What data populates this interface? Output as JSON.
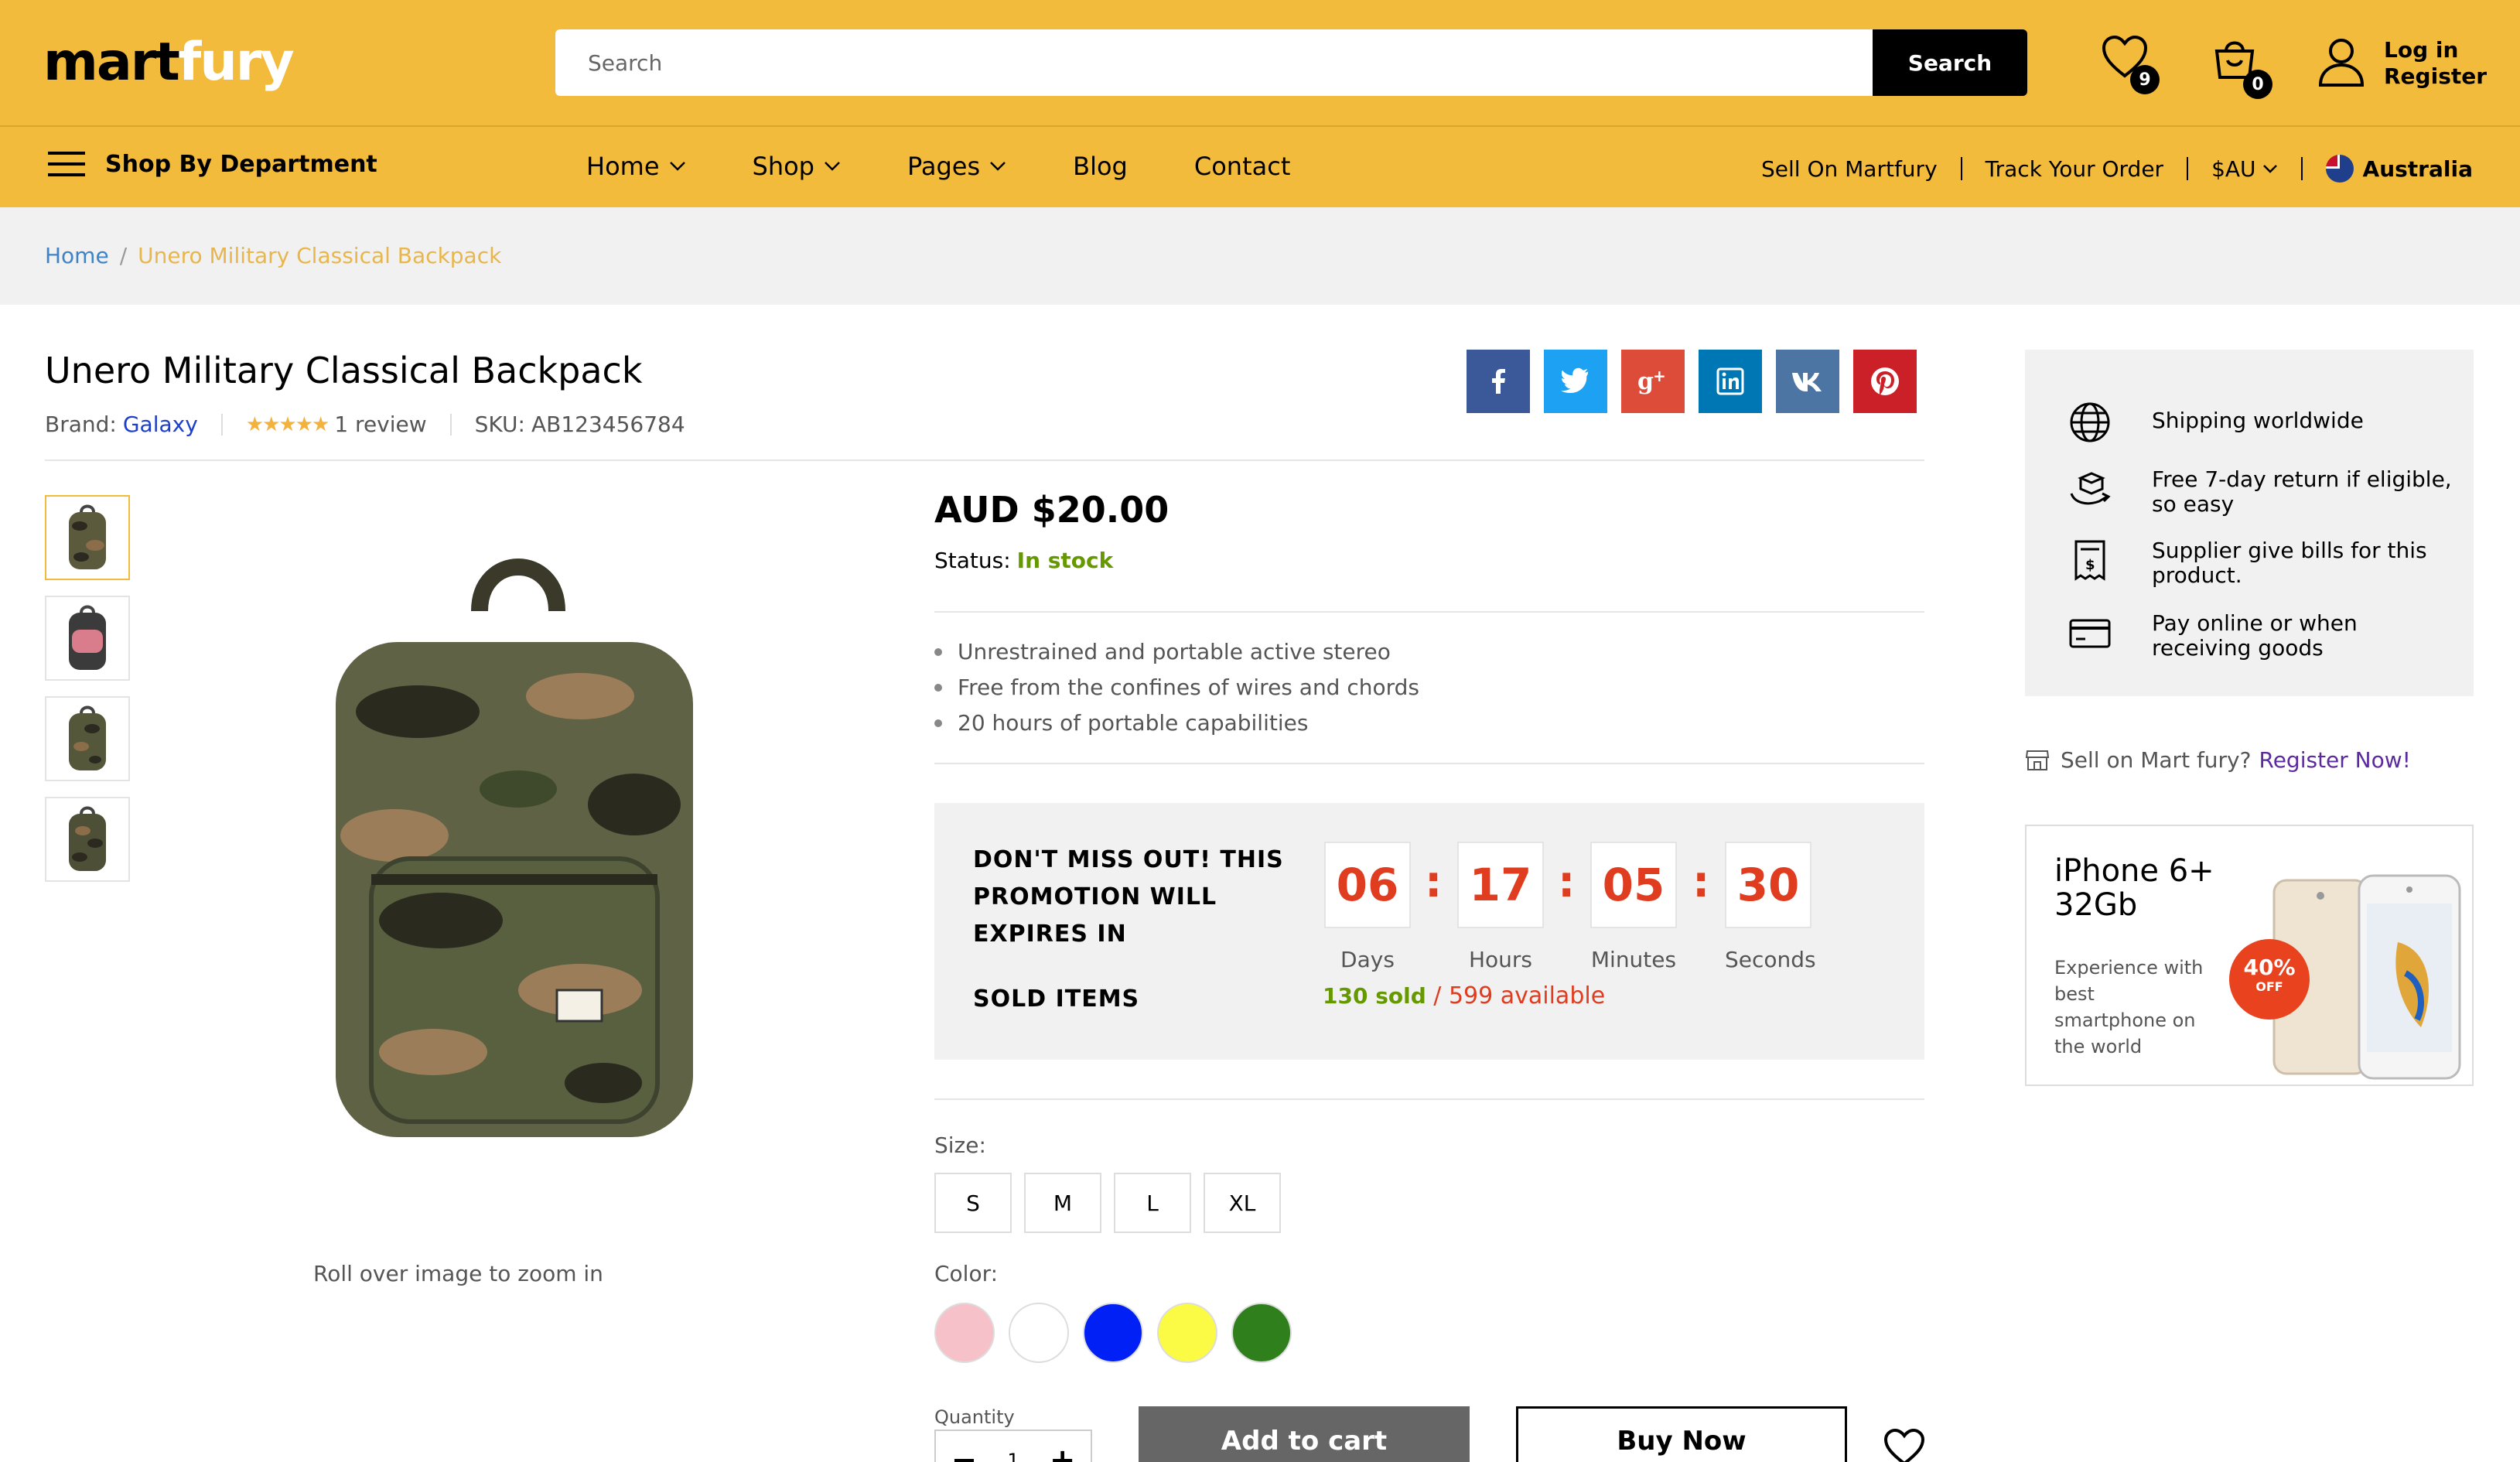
{
  "header": {
    "logo_part1": "mart",
    "logo_part2": "fury",
    "search_placeholder": "Search",
    "search_button": "Search",
    "wishlist_count": "9",
    "cart_count": "0",
    "login_label": "Log in",
    "register_label": "Register"
  },
  "nav": {
    "department_label": "Shop By Department",
    "items": [
      "Home",
      "Shop",
      "Pages",
      "Blog",
      "Contact"
    ],
    "sell_label": "Sell On Martfury",
    "track_label": "Track Your Order",
    "currency": "$AU",
    "country": "Australia"
  },
  "breadcrumb": {
    "home": "Home",
    "separator": "/",
    "current": "Unero Military Classical Backpack"
  },
  "product": {
    "title": "Unero Military Classical Backpack",
    "brand_label": "Brand:",
    "brand": "Galaxy",
    "rating_stars": "★★★★★",
    "reviews": "1 review",
    "sku_label": "SKU:",
    "sku": "AB123456784",
    "zoom_hint": "Roll over image to zoom in",
    "price": "AUD $20.00",
    "status_label": "Status:",
    "status_value": "In stock",
    "features": [
      "Unrestrained and portable active stereo",
      "Free from the confines of wires and chords",
      "20 hours of portable capabilities"
    ],
    "social_icons": [
      "facebook-icon",
      "twitter-icon",
      "google-plus-icon",
      "linkedin-icon",
      "vk-icon",
      "pinterest-icon"
    ],
    "social_colors": [
      "#3b5998",
      "#1da1f2",
      "#dd4b39",
      "#0077b5",
      "#4c75a3",
      "#cb2027"
    ]
  },
  "promo": {
    "title": "DON'T MISS OUT! THIS PROMOTION WILL EXPIRES IN",
    "countdown": [
      {
        "value": "06",
        "label": "Days"
      },
      {
        "value": "17",
        "label": "Hours"
      },
      {
        "value": "05",
        "label": "Minutes"
      },
      {
        "value": "30",
        "label": "Seconds"
      }
    ],
    "colon": ":",
    "sold_label": "SOLD ITEMS",
    "sold": "130 sold",
    "available": "/ 599 available"
  },
  "options": {
    "size_label": "Size:",
    "sizes": [
      "S",
      "M",
      "L",
      "XL"
    ],
    "color_label": "Color:",
    "colors": [
      "#f6c1c9",
      "#ffffff",
      "#0020f5",
      "#fbfb45",
      "#2f7f1d"
    ],
    "quantity_label": "Quantity",
    "quantity_value": "1",
    "minus": "−",
    "plus": "+",
    "add_to_cart": "Add to cart",
    "buy_now": "Buy Now"
  },
  "sidebar": {
    "shipping": [
      {
        "icon": "globe-icon",
        "text": "Shipping worldwide"
      },
      {
        "icon": "return-box-icon",
        "text": "Free 7-day return if eligible, so easy"
      },
      {
        "icon": "receipt-icon",
        "text": "Supplier give bills for this product."
      },
      {
        "icon": "credit-card-icon",
        "text": "Pay online or when receiving goods"
      }
    ],
    "sell_text": "Sell on Mart fury?",
    "register_link": "Register Now!",
    "ad": {
      "title": "iPhone 6+ 32Gb",
      "desc": "Experience with best smartphone on the world",
      "badge_percent": "40%",
      "badge_off": "OFF"
    }
  },
  "colors": {
    "brand_yellow": "#F3BB3C",
    "countdown_red": "#e03c1f",
    "stock_green": "#669900"
  }
}
